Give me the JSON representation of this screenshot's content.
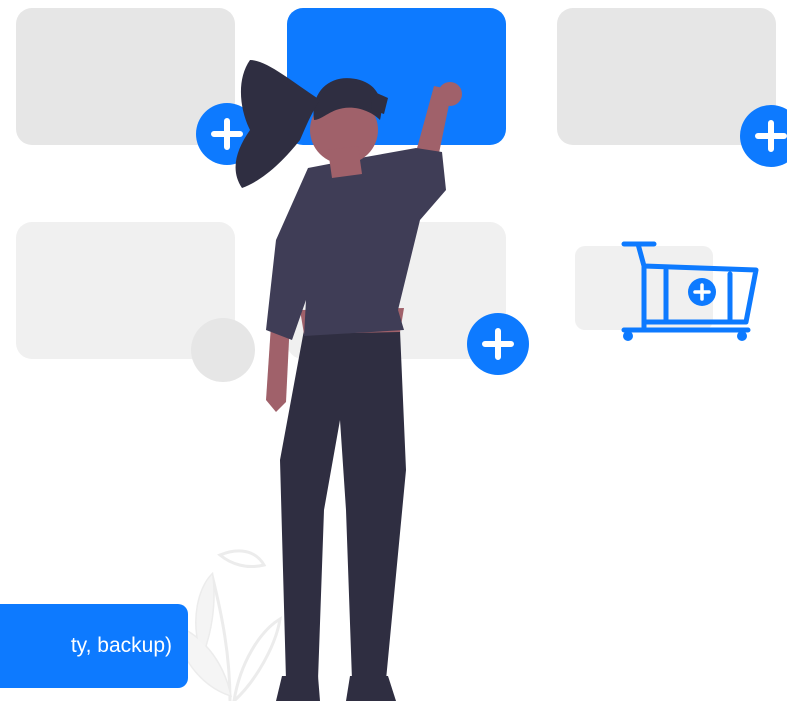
{
  "colors": {
    "accent": "#0d7aff",
    "card": "#e6e6e6",
    "card_light": "#f0f0f0",
    "white": "#ffffff"
  },
  "icons": [
    "plus-icon",
    "shopping-cart-icon"
  ],
  "tag": {
    "label": "ty, backup)"
  }
}
